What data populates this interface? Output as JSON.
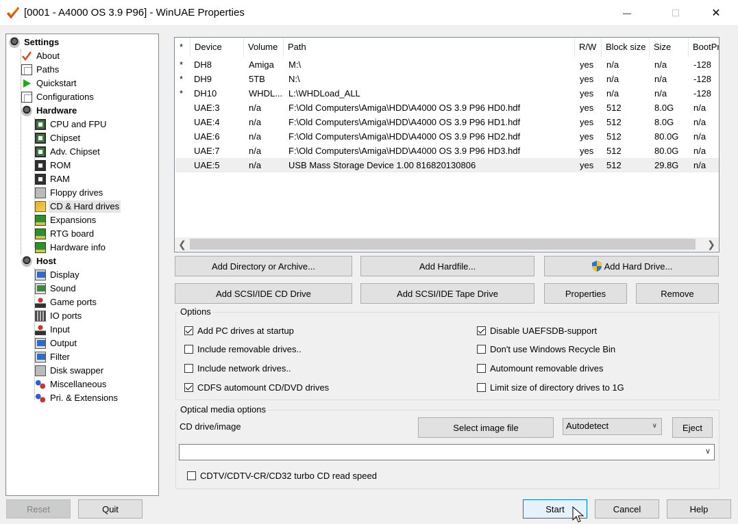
{
  "window": {
    "title": "[0001 - A4000 OS 3.9 P96] - WinUAE Properties",
    "minimize_glyph": "—",
    "maximize_glyph": "☐",
    "close_glyph": "✕"
  },
  "tree": {
    "settings": "Settings",
    "about": "About",
    "paths": "Paths",
    "quickstart": "Quickstart",
    "configurations": "Configurations",
    "hardware": "Hardware",
    "hardware_items": [
      "CPU and FPU",
      "Chipset",
      "Adv. Chipset",
      "ROM",
      "RAM",
      "Floppy drives",
      "CD & Hard drives",
      "Expansions",
      "RTG board",
      "Hardware info"
    ],
    "host": "Host",
    "host_items": [
      "Display",
      "Sound",
      "Game ports",
      "IO ports",
      "Input",
      "Output",
      "Filter",
      "Disk swapper",
      "Miscellaneous",
      "Pri. & Extensions"
    ],
    "selected": "CD & Hard drives"
  },
  "device_list": {
    "columns": [
      "*",
      "Device",
      "Volume",
      "Path",
      "R/W",
      "Block size",
      "Size",
      "BootPri"
    ],
    "rows": [
      [
        "*",
        "DH8",
        "Amiga",
        "M:\\",
        "yes",
        "n/a",
        "n/a",
        "-128"
      ],
      [
        "*",
        "DH9",
        "5TB",
        "N:\\",
        "yes",
        "n/a",
        "n/a",
        "-128"
      ],
      [
        "*",
        "DH10",
        "WHDL...",
        "L:\\WHDLoad_ALL",
        "yes",
        "n/a",
        "n/a",
        "-128"
      ],
      [
        "",
        "UAE:3",
        "n/a",
        "F:\\Old Computers\\Amiga\\HDD\\A4000 OS 3.9 P96 HD0.hdf",
        "yes",
        "512",
        "8.0G",
        "n/a"
      ],
      [
        "",
        "UAE:4",
        "n/a",
        "F:\\Old Computers\\Amiga\\HDD\\A4000 OS 3.9 P96 HD1.hdf",
        "yes",
        "512",
        "8.0G",
        "n/a"
      ],
      [
        "",
        "UAE:6",
        "n/a",
        "F:\\Old Computers\\Amiga\\HDD\\A4000 OS 3.9 P96 HD2.hdf",
        "yes",
        "512",
        "80.0G",
        "n/a"
      ],
      [
        "",
        "UAE:7",
        "n/a",
        "F:\\Old Computers\\Amiga\\HDD\\A4000 OS 3.9 P96 HD3.hdf",
        "yes",
        "512",
        "80.0G",
        "n/a"
      ],
      [
        "",
        "UAE:5",
        "n/a",
        "USB Mass Storage Device 1.00 816820130806",
        "yes",
        "512",
        "29.8G",
        "n/a"
      ]
    ]
  },
  "buttons": {
    "add_directory": "Add Directory or Archive...",
    "add_hardfile": "Add Hardfile...",
    "add_hard_drive": "Add Hard Drive...",
    "add_scsi_cd": "Add SCSI/IDE CD Drive",
    "add_scsi_tape": "Add SCSI/IDE Tape Drive",
    "properties": "Properties",
    "remove": "Remove"
  },
  "options": {
    "title": "Options",
    "items": [
      {
        "label": "Add PC drives at startup",
        "checked": true
      },
      {
        "label": "Include removable drives..",
        "checked": false
      },
      {
        "label": "Include network drives..",
        "checked": false
      },
      {
        "label": "CDFS automount CD/DVD drives",
        "checked": true
      },
      {
        "label": "Disable UAEFSDB-support",
        "checked": true
      },
      {
        "label": "Don't use Windows Recycle Bin",
        "checked": false
      },
      {
        "label": "Automount removable drives",
        "checked": false
      },
      {
        "label": "Limit size of directory drives to 1G",
        "checked": false
      }
    ]
  },
  "optical": {
    "title": "Optical media options",
    "cd_label": "CD drive/image",
    "select_image": "Select image file",
    "mode_value": "Autodetect",
    "eject": "Eject",
    "path_value": "",
    "turbo_label": "CDTV/CDTV-CR/CD32 turbo CD read speed",
    "turbo_checked": false
  },
  "footer": {
    "reset": "Reset",
    "quit": "Quit",
    "start": "Start",
    "cancel": "Cancel",
    "help": "Help"
  },
  "colors": {
    "accent": "#0078d7",
    "selection": "#e5e5e5"
  }
}
